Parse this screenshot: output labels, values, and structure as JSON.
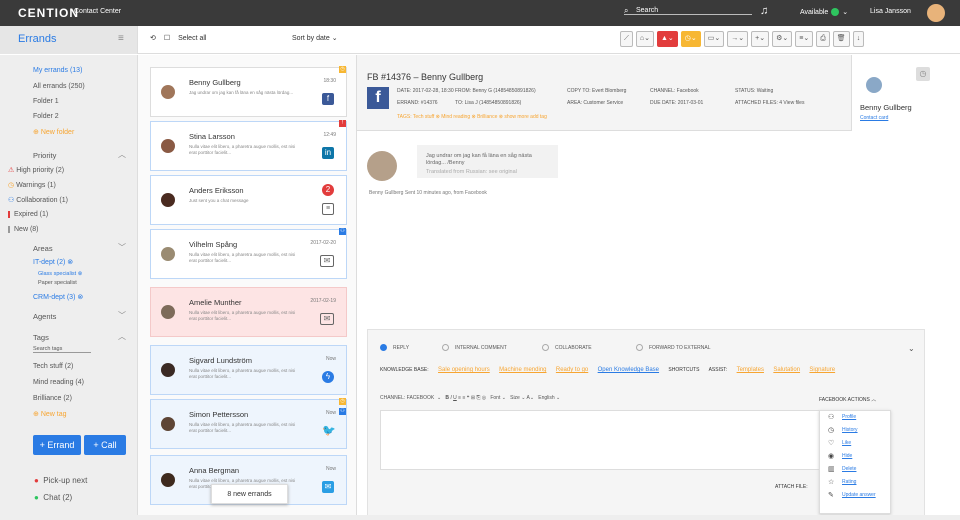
{
  "topbar": {
    "brand": "CENTION",
    "product": "Contact Center",
    "search": "Search",
    "status": "Available",
    "user": "Lisa Jansson"
  },
  "toolbar": {
    "section": "Errands",
    "select_all": "Select all",
    "sort": "Sort by date"
  },
  "sidebar": {
    "my_errands": "My errands (13)",
    "all_errands": "All errands (250)",
    "folder1": "Folder 1",
    "folder2": "Folder 2",
    "new_folder": "New folder",
    "priority": "Priority",
    "high": "High priority (2)",
    "warnings": "Warnings (1)",
    "collab": "Collaboration (1)",
    "expired": "Expired (1)",
    "new": "New (8)",
    "areas": "Areas",
    "it": "IT-dept (2)",
    "glass": "Glass specialist",
    "paper": "Paper specialist",
    "crm": "CRM-dept (3)",
    "agents": "Agents",
    "tags": "Tags",
    "search_tags": "Search tags",
    "tech": "Tech stuff (2)",
    "mind": "Mind reading (4)",
    "brill": "Brilliance (2)",
    "new_tag": "New tag",
    "errand_btn": "+ Errand",
    "call_btn": "+ Call",
    "pickup": "Pick-up next",
    "chat": "Chat (2)"
  },
  "list": [
    {
      "name": "Benny Gullberg",
      "text": "Jag undrar om jag kan få läna en såg nästa lördag...",
      "time": "18:30",
      "channel": "facebook"
    },
    {
      "name": "Stina Larsson",
      "text": "Nulla vitae elit libero, a pharetra augue mollis, est nisi erat porttitor facielit...",
      "time": "12:49",
      "channel": "linkedin"
    },
    {
      "name": "Anders Eriksson",
      "text": "Just sent you a chat message",
      "time": "",
      "channel": "chat",
      "badge": "2"
    },
    {
      "name": "Vilhelm Spång",
      "text": "Nulla vitae elit libero, a pharetra augue mollis, est nisi erat porttitor facielit...",
      "time": "2017-02-20",
      "channel": "mail"
    },
    {
      "name": "Amelie Munther",
      "text": "Nulla vitae elit libero, a pharetra augue mollis, est nisi erat porttitor facielit...",
      "time": "2017-02-19",
      "channel": "mail"
    },
    {
      "name": "Sigvard Lundström",
      "text": "Nulla vitae elit libero, a pharetra augue mollis, est nisi erat porttitor facielit...",
      "time": "Now",
      "channel": "messenger"
    },
    {
      "name": "Simon Pettersson",
      "text": "Nulla vitae elit libero, a pharetra augue mollis, est nisi erat porttitor facielit...",
      "time": "Now",
      "channel": "twitter"
    },
    {
      "name": "Anna Bergman",
      "text": "Nulla vitae elit libero, a pharetra augue mollis, est nisi erat porttitor...",
      "time": "Now",
      "channel": "mail"
    }
  ],
  "toast": "8 new errands",
  "detail": {
    "title": "FB #14376 – Benny Gullberg",
    "date": "DATE: 2017-02-28, 18:30",
    "from": "FROM: Benny G (14854850891826)",
    "copy": "COPY TO: Evert Blomberg",
    "channel": "CHANNEL: Facebook",
    "status": "STATUS: Waiting",
    "errand": "ERRAND: #14376",
    "to": "TO: Lisa J (14854850891826)",
    "area": "AREA: Customer Service",
    "due": "DUE DATE: 2017-03-01",
    "files": "ATTACHED FILES: 4 View files",
    "tags": "TAGS: Tech stuff ⊗ Mind reading ⊗ Brilliance ⊗ show more add tag",
    "contact_name": "Benny Gullberg",
    "contact_card": "Contact card",
    "message": "Jag undrar om jag kan få läna en såg nästa lördag... /Benny",
    "translated": "Translated from Russian: see original",
    "sub": "Benny Gullberg     Sent 10 minutes ago, from Facebook"
  },
  "reply": {
    "r1": "REPLY",
    "r2": "INTERNAL COMMENT",
    "r3": "COLLABORATE",
    "r4": "FORWARD TO EXTERNAL",
    "kb_label": "KNOWLEDGE BASE:",
    "kb1": "Sale opening hours",
    "kb2": "Machine mending",
    "kb3": "Ready to go",
    "kb_open": "Open Knowledge Base",
    "shortcuts": "SHORTCUTS",
    "assist": "ASSIST:",
    "templates": "Templates",
    "salutation": "Salutation",
    "signature": "Signature",
    "channel": "CHANNEL: FACEBOOK",
    "font": "Font",
    "size": "Size",
    "lang": "English",
    "attach": "ATTACH FILE:",
    "fb_actions": "FACEBOOK ACTIONS",
    "actions": [
      "Profile",
      "History",
      "Like",
      "Hide",
      "Delete",
      "Rating",
      "Update answer"
    ]
  }
}
